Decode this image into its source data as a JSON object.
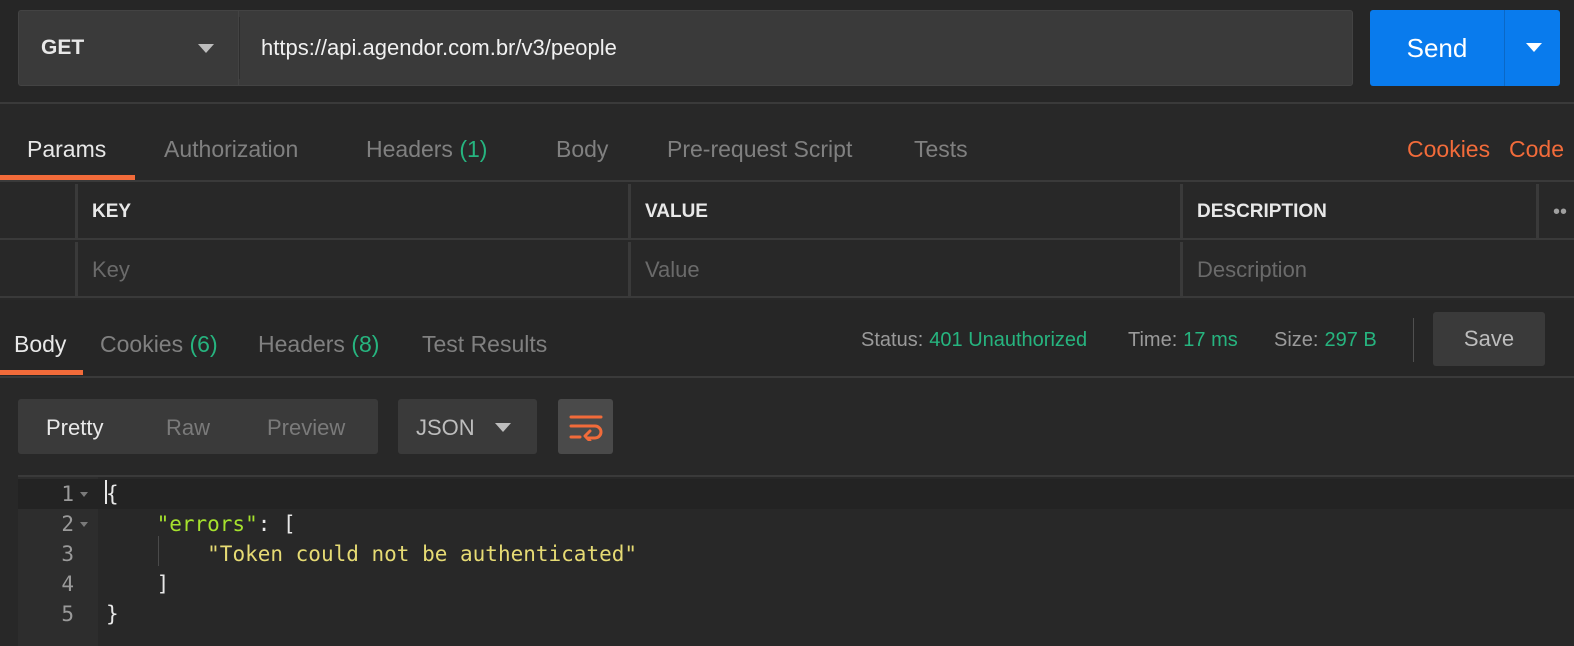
{
  "request": {
    "method": "GET",
    "url": "https://api.agendor.com.br/v3/people",
    "send_label": "Send"
  },
  "request_tabs": {
    "params": "Params",
    "authorization": "Authorization",
    "headers": "Headers",
    "headers_count": "(1)",
    "body": "Body",
    "prerequest": "Pre-request Script",
    "tests": "Tests",
    "cookies": "Cookies",
    "code": "Code"
  },
  "params_table": {
    "headers": {
      "key": "KEY",
      "value": "VALUE",
      "description": "DESCRIPTION"
    },
    "placeholders": {
      "key": "Key",
      "value": "Value",
      "description": "Description"
    }
  },
  "response_tabs": {
    "body": "Body",
    "cookies": "Cookies",
    "cookies_count": "(6)",
    "headers": "Headers",
    "headers_count": "(8)",
    "test_results": "Test Results"
  },
  "response_meta": {
    "status_label": "Status:",
    "status_value": "401 Unauthorized",
    "time_label": "Time:",
    "time_value": "17 ms",
    "size_label": "Size:",
    "size_value": "297 B",
    "save_label": "Save"
  },
  "body_toolbar": {
    "pretty": "Pretty",
    "raw": "Raw",
    "preview": "Preview",
    "format": "JSON"
  },
  "code_lines": [
    {
      "number": "1",
      "open": "{"
    },
    {
      "number": "2",
      "key": "\"errors\"",
      "rest": ": ["
    },
    {
      "number": "3",
      "string": "\"Token could not be authenticated\""
    },
    {
      "number": "4",
      "close": "]"
    },
    {
      "number": "5",
      "close": "}"
    }
  ],
  "colors": {
    "accent_blue": "#097bed",
    "accent_orange": "#f26b3a",
    "success_green": "#26b47f",
    "json_key": "#a6e22e",
    "json_string": "#e6db74"
  }
}
